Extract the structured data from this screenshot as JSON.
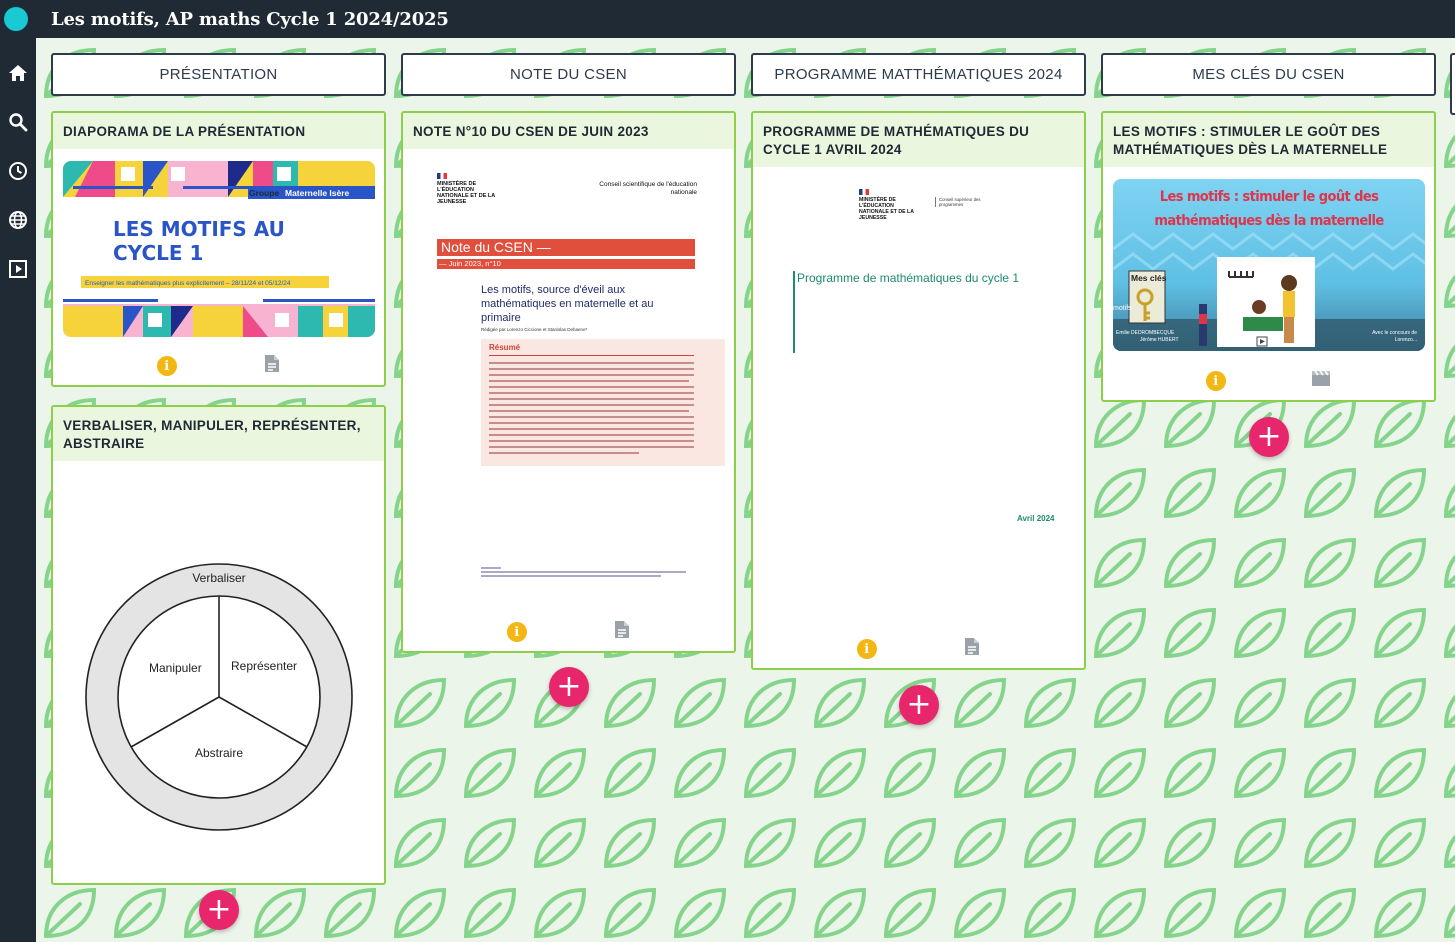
{
  "app": {
    "board_title": "Les motifs, AP maths Cycle 1 2024/2025"
  },
  "sidebar": {
    "icons": [
      "home-icon",
      "search-icon",
      "clock-icon",
      "globe-icon",
      "slideshow-icon"
    ]
  },
  "columns": [
    {
      "header": "Présentation",
      "cards": [
        {
          "title": "Diaporama de la présentation",
          "thumb": {
            "title_line1": "LES MOTIFS AU",
            "title_line2": "CYCLE 1",
            "badge": "Groupe",
            "badge2": "Maternelle Isère",
            "subtitle": "Enseigner les mathématiques plus explicitement – 28/11/24 et 05/12/24"
          },
          "footer_icons": [
            "info-icon",
            "document-icon"
          ]
        },
        {
          "title": "Verbaliser, manipuler, représenter, abstraire",
          "diagram": {
            "outer": "Verbaliser",
            "left": "Manipuler",
            "right": "Représenter",
            "bottom": "Abstraire"
          }
        }
      ]
    },
    {
      "header": "Note du CSEN",
      "cards": [
        {
          "title": "Note n°10 du CSEN de juin 2023",
          "doc": {
            "ministry": "MINISTÈRE DE L'ÉDUCATION NATIONALE ET DE LA JEUNESSE",
            "council": "Conseil scientifique de l'éducation nationale",
            "banner": "Note du CSEN —",
            "date": "— Juin 2023, n°10",
            "heading": "Les motifs, source d'éveil aux mathématiques en maternelle et au primaire",
            "authors": "Rédigée par Lorenzo Ciccione et Stanislas Dehaene*",
            "summary_title": "Résumé"
          },
          "footer_icons": [
            "info-icon",
            "document-icon"
          ]
        }
      ]
    },
    {
      "header": "Programme matthématiques 2024",
      "cards": [
        {
          "title": "Programme de mathématiques du cycle 1 avril 2024",
          "doc": {
            "ministry": "MINISTÈRE DE L'ÉDUCATION NATIONALE ET DE LA JEUNESSE",
            "council": "Conseil supérieur des programmes",
            "program_title": "Programme de mathématiques du cycle 1",
            "date": "Avril 2024"
          },
          "footer_icons": [
            "info-icon",
            "document-icon"
          ]
        }
      ]
    },
    {
      "header": "Mes clés du CSEN",
      "cards": [
        {
          "title": "Les motifs : stimuler le goût des mathématiques dès la maternelle",
          "video": {
            "title_line1": "Les motifs : stimuler le goût des",
            "title_line2": "mathématiques dès la maternelle",
            "keys_label": "Mes clés",
            "side_label": "motifs",
            "credits_left_1": "Emilie DEDROMBECQUE",
            "credits_left_2": "Jérôme HUBERT",
            "credits_right_1": "Avec le concours de",
            "credits_right_2": "Lorenzo..."
          },
          "footer_icons": [
            "info-icon",
            "video-icon"
          ]
        }
      ]
    }
  ],
  "add_label": "+",
  "colors": {
    "topbar": "#1f2a35",
    "accent_add": "#e7266b",
    "card_border": "#8bcf4a",
    "info": "#f3b713"
  }
}
